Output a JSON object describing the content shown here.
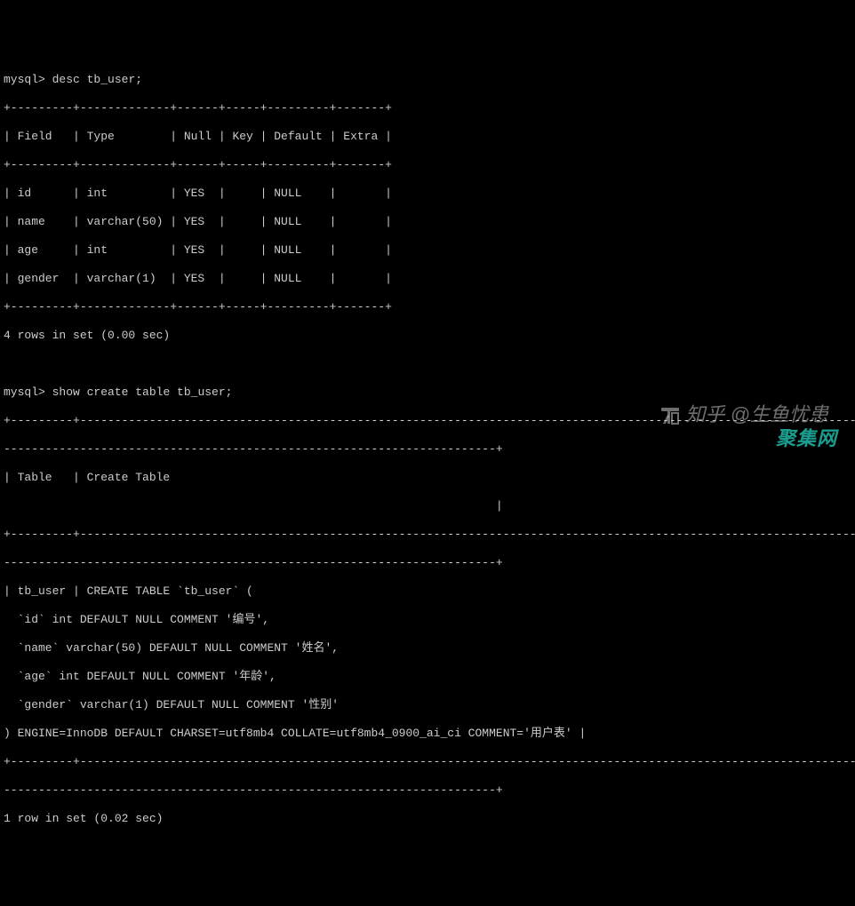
{
  "cmd1": {
    "prompt": "mysql>",
    "command": "desc tb_user;"
  },
  "table1": {
    "border_top": "+---------+-------------+------+-----+---------+-------+",
    "header": "| Field   | Type        | Null | Key | Default | Extra |",
    "border_mid": "+---------+-------------+------+-----+---------+-------+",
    "rows": [
      "| id      | int         | YES  |     | NULL    |       |",
      "| name    | varchar(50) | YES  |     | NULL    |       |",
      "| age     | int         | YES  |     | NULL    |       |",
      "| gender  | varchar(1)  | YES  |     | NULL    |       |"
    ],
    "border_bot": "+---------+-------------+------+-----+---------+-------+",
    "footer": "4 rows in set (0.00 sec)"
  },
  "cmd2": {
    "prompt": "mysql>",
    "command": "show create table tb_user;"
  },
  "table2": {
    "border1": "+---------+--------------------------------------------------------------------------------------------------------------------------------",
    "border1b": "-----------------------------------------------------------------------+",
    "header": "| Table   | Create Table",
    "header_end": "                                                                       |",
    "border2": "+---------+--------------------------------------------------------------------------------------------------------------------------------",
    "border2b": "-----------------------------------------------------------------------+",
    "row_lines": [
      "| tb_user | CREATE TABLE `tb_user` (",
      "  `id` int DEFAULT NULL COMMENT '编号',",
      "  `name` varchar(50) DEFAULT NULL COMMENT '姓名',",
      "  `age` int DEFAULT NULL COMMENT '年龄',",
      "  `gender` varchar(1) DEFAULT NULL COMMENT '性别'",
      ") ENGINE=InnoDB DEFAULT CHARSET=utf8mb4 COLLATE=utf8mb4_0900_ai_ci COMMENT='用户表' |"
    ],
    "border3": "+---------+--------------------------------------------------------------------------------------------------------------------------------",
    "border3b": "-----------------------------------------------------------------------+",
    "footer": "1 row in set (0.02 sec)"
  },
  "watermark1": "@生鱼忧患",
  "watermark1_brand": "知乎",
  "watermark2": "聚集网"
}
